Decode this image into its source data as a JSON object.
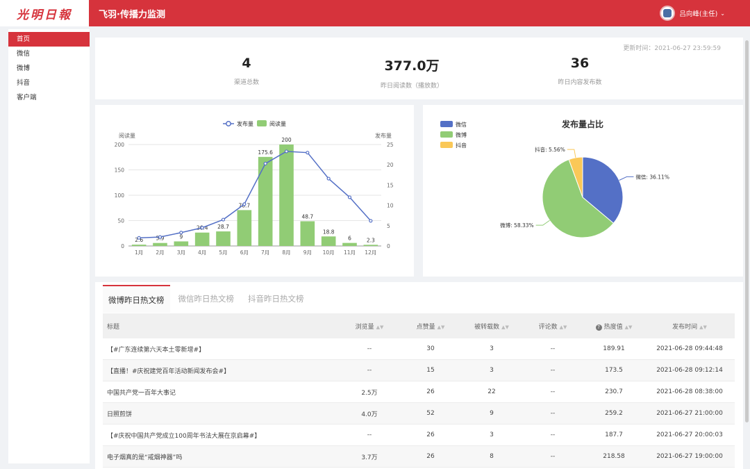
{
  "header": {
    "logo_text": "光明日報",
    "app_title": "飞羽·传播力监测",
    "user_name": "吕向峰(主任)"
  },
  "sidebar": {
    "items": [
      {
        "label": "首页",
        "active": true
      },
      {
        "label": "微信"
      },
      {
        "label": "微博"
      },
      {
        "label": "抖音"
      },
      {
        "label": "客户端"
      }
    ]
  },
  "stats": {
    "update_time": "更新时间：2021-06-27 23:59:59",
    "items": [
      {
        "value": "4",
        "label": "渠道总数"
      },
      {
        "value": "377.0万",
        "label": "昨日阅读数（播放数）"
      },
      {
        "value": "36",
        "label": "昨日内容发布数"
      }
    ]
  },
  "colors": {
    "brand": "#d6333c",
    "bar_green": "#91cc75",
    "line_blue": "#5470c6",
    "pie_wechat": "#5470c6",
    "pie_weibo": "#91cc75",
    "pie_douyin": "#fac858"
  },
  "chart_data": [
    {
      "type": "bar",
      "legend": [
        "发布量",
        "阅读量"
      ],
      "ylabel_left": "阅读量",
      "ylabel_right": "发布量",
      "ylim_left": [
        0,
        200
      ],
      "ylim_right": [
        0,
        25
      ],
      "yticks_left": [
        "0",
        "50",
        "100",
        "150",
        "200"
      ],
      "yticks_right": [
        "0",
        "5",
        "10",
        "15",
        "20",
        "25"
      ],
      "categories": [
        "1月",
        "2月",
        "3月",
        "4月",
        "5月",
        "6月",
        "7月",
        "8月",
        "9月",
        "10月",
        "11月",
        "12月"
      ],
      "series": [
        {
          "name": "阅读量",
          "kind": "bar",
          "axis": "left",
          "values": [
            2.6,
            5.9,
            9,
            26.4,
            28.7,
            70.7,
            175.6,
            200,
            48.7,
            18.8,
            6,
            2.3
          ],
          "labels": [
            "2.6",
            "5.9",
            "9",
            "26.4",
            "28.7",
            "70.7",
            "175.6",
            "200",
            "48.7",
            "18.8",
            "6",
            "2.3"
          ]
        },
        {
          "name": "发布量",
          "kind": "line",
          "axis": "right",
          "values": [
            2,
            2.2,
            3.3,
            4.5,
            6.5,
            10.3,
            20.3,
            23.3,
            23,
            16.6,
            12,
            6.2
          ]
        }
      ]
    },
    {
      "type": "pie",
      "title": "发布量占比",
      "slices": [
        {
          "name": "微信",
          "value": 36.11,
          "label": "微信: 36.11%"
        },
        {
          "name": "微博",
          "value": 58.33,
          "label": "微博: 58.33%"
        },
        {
          "name": "抖音",
          "value": 5.56,
          "label": "抖音: 5.56%"
        }
      ]
    }
  ],
  "table": {
    "tabs": [
      "微博昨日热文榜",
      "微信昨日热文榜",
      "抖音昨日热文榜"
    ],
    "columns": [
      "标题",
      "浏览量",
      "点赞量",
      "被转载数",
      "评论数",
      "热度值",
      "发布时间"
    ],
    "rows": [
      [
        "【#广东连续第六天本土零新增#】",
        "--",
        "30",
        "3",
        "--",
        "189.91",
        "2021-06-28 09:44:48"
      ],
      [
        "【直播！#庆祝建党百年活动新闻发布会#】",
        "--",
        "15",
        "3",
        "--",
        "173.5",
        "2021-06-28 09:12:14"
      ],
      [
        "中国共产党一百年大事记",
        "2.5万",
        "26",
        "22",
        "--",
        "230.7",
        "2021-06-28 08:38:00"
      ],
      [
        "日照煎饼",
        "4.0万",
        "52",
        "9",
        "--",
        "259.2",
        "2021-06-27 21:00:00"
      ],
      [
        "【#庆祝中国共产党成立100周年书法大展在京启幕#】",
        "--",
        "26",
        "3",
        "--",
        "187.7",
        "2021-06-27 20:00:03"
      ],
      [
        "电子烟真的是“戒烟神器”吗",
        "3.7万",
        "26",
        "8",
        "--",
        "218.58",
        "2021-06-27 19:00:00"
      ]
    ]
  }
}
